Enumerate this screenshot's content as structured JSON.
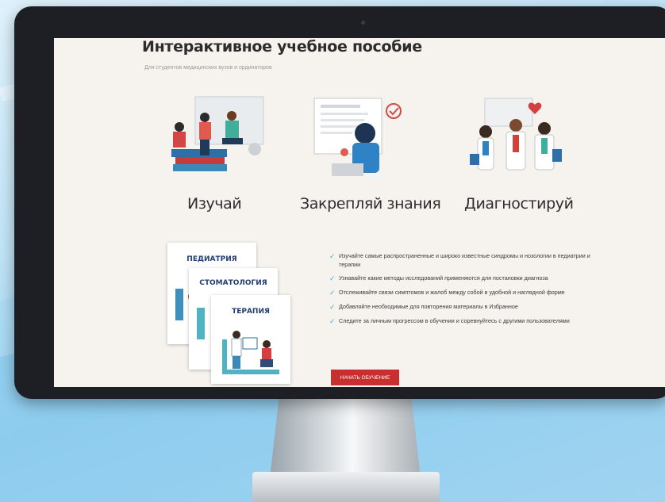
{
  "page": {
    "title": "Интерактивное учебное пособие",
    "subtitle": "Для студентов медицинских вузов и ординаторов"
  },
  "features": [
    {
      "label": "Изучай",
      "icon": "students-studying-illustration"
    },
    {
      "label": "Закрепляй знания",
      "icon": "woman-at-laptop-illustration"
    },
    {
      "label": "Диагностируй",
      "icon": "doctors-team-illustration"
    }
  ],
  "cards": [
    {
      "label": "ПЕДИАТРИЯ"
    },
    {
      "label": "СТОМАТОЛОГИЯ"
    },
    {
      "label": "ТЕРАПИЯ"
    }
  ],
  "benefits": [
    "Изучайте самые распространенные и широко известные синдромы и нозологии в педиатрии и терапии",
    "Узнавайте какие методы исследований применяются для постановки диагноза",
    "Отслеживайте связи симптомов и жалоб между собой в удобной и наглядной форме",
    "Добавляйте необходимые для повторения материалы в Избранное",
    "Следите за личным прогрессом в обучении и соревнуйтесь с другими пользователями"
  ],
  "cta": {
    "label": "НАЧАТЬ ОБУЧЕНИЕ"
  },
  "colors": {
    "accent": "#c8302f",
    "heading": "#1f3f73",
    "check": "#5aa5c8",
    "screen_bg": "#f6f3ee"
  }
}
